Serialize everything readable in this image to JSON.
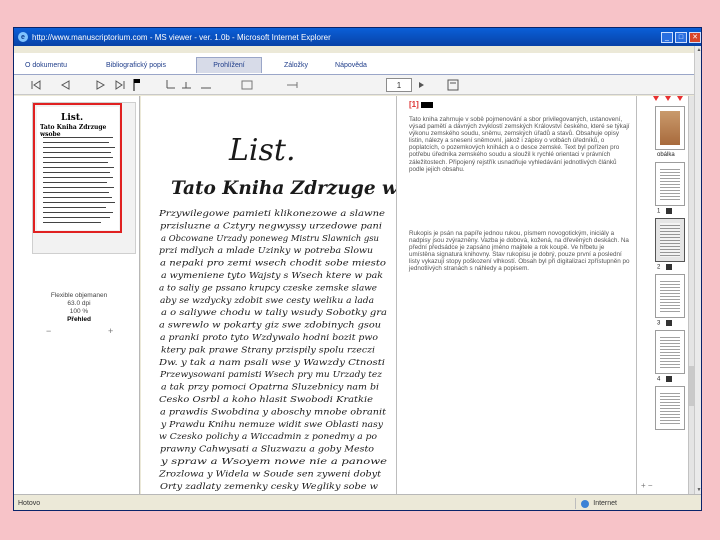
{
  "window": {
    "title": "http://www.manuscriptorium.com - MS viewer - ver. 1.0b - Microsoft Internet Explorer",
    "ie_icon": "e",
    "controls": [
      "_",
      "□",
      "✕"
    ]
  },
  "tabs": [
    {
      "label": "O dokumentu"
    },
    {
      "label": "Bibliografický popis"
    },
    {
      "label": "Prohlížení"
    },
    {
      "label": "Záložky"
    },
    {
      "label": "Nápověda"
    }
  ],
  "toolbar": {
    "page_select": "1",
    "icons": [
      "first-page-icon",
      "prev-page-icon",
      "next-page-icon",
      "last-page-icon",
      "flag-icon",
      "zoom-out-icon",
      "zoom-in-icon",
      "fit-width-icon",
      "fit-page-icon",
      "rotate-icon",
      "print-icon"
    ]
  },
  "left_panel": {
    "thumb_title_1": "List.",
    "thumb_title_2": "Tato Kniha Zdrzuge wsobe",
    "info_line1": "Flexible objemanen",
    "info_line2": "63.0 dpi",
    "info_line3": "100 %",
    "info_line4": "Přehled",
    "zoom_minus": "−",
    "zoom_plus": "+"
  },
  "manuscript": {
    "heading1": "List.",
    "heading2": "Tato Kniha Zdrzuge wsobe",
    "lines": [
      "Przywilegowe pamieti klikonezowe a slawne",
      "przisluzne a Cztyry negwyssy urzedowe pani",
      "a Obcowane Urzady poneweg Mistru Slawnich gsu",
      "przi mdlych a mlade Uzinky w potreba Slowu",
      "a nepaki pro zemi wsech chodit sobe miesto",
      "a wymeniene tyto Wajsty s Wsech ktere w pak",
      "a to saliy ge pssano krupcy czeske zemske slawe",
      "aby se wzdycky zdobit swe cesty weliku a lada",
      "a o saliywe chodu w taliy wsudy Sobotky gra",
      "a swrewlo w pokarty giz swe zdobinych gsou",
      "a pranki proto tyto Wzdywalo hodni bozit pwo",
      "ktery pak prawe Strany przispily spolu rzeczi",
      "Dw. y tak a nam psali wse y Wawzdy Ctnosti",
      "Przewysowani pamisti Wsech pry mu Urzady tez",
      "a tak przy pomoci Opatrna Sluzebnicy nam bi",
      "Cesko Osrbl a koho hlasit Swobodi Kratkie",
      "a prawdis Swobdina y aboschy mnobe obranit",
      "y Prawdu Knihu nemuze widit swe Oblasti nasy",
      "w Czesko polichy a Wiccadmin z ponedmy a po",
      "prawny Cahwysati a Sluzwazu a goby Mesto",
      "y spraw a Wsoyem nowe nie a panowe",
      "Zrozlowa y Widela w Soude sen zyweni dobyt",
      "Orty zadlaty zemenky cesky Wegliky sobe w"
    ]
  },
  "text_panel": {
    "page_number": "[1]",
    "para1": "Tato kniha zahrnuje v sobě pojmenování a sbor privilegovaných, ustanovení, výsad pamětí a dávných zvyklostí zemských Království českého, které se týkají výkonu zemského soudu, sněmu, zemských úřadů a stavů. Obsahuje opisy listin, nálezy a snesení sněmovní, jakož i zápisy o volbách úředníků, o poplatcích, o pozemkových knihách a o desce zemské. Text byl pořízen pro potřebu úředníka zemského soudu a sloužil k rychlé orientaci v právních záležitostech. Připojený rejstřík usnadňuje vyhledávání jednotlivých článků podle jejich obsahu.",
    "para2": "Rukopis je psán na papíře jednou rukou, písmem novogotickým, iniciály a nadpisy jsou zvýrazněny. Vazba je dobová, kožená, na dřevěných deskách. Na přední předsádce je zapsáno jméno majitele a rok koupě. Ve hřbetu je umístěna signatura knihovny. Stav rukopisu je dobrý, pouze první a poslední listy vykazují stopy poškození vlhkostí. Obsah byl při digitalizaci zpřístupněn po jednotlivých stranách s náhledy a popisem."
  },
  "right_panel": {
    "labels": [
      "obálka",
      "1",
      "2",
      "3",
      "4"
    ],
    "zoom": "+ −"
  },
  "status": {
    "left": "Hotovo",
    "zone": "Internet"
  },
  "colors": {
    "background": "#f7c3c8",
    "titlebar": "#0a5fd8",
    "accent_red": "#e02020"
  }
}
